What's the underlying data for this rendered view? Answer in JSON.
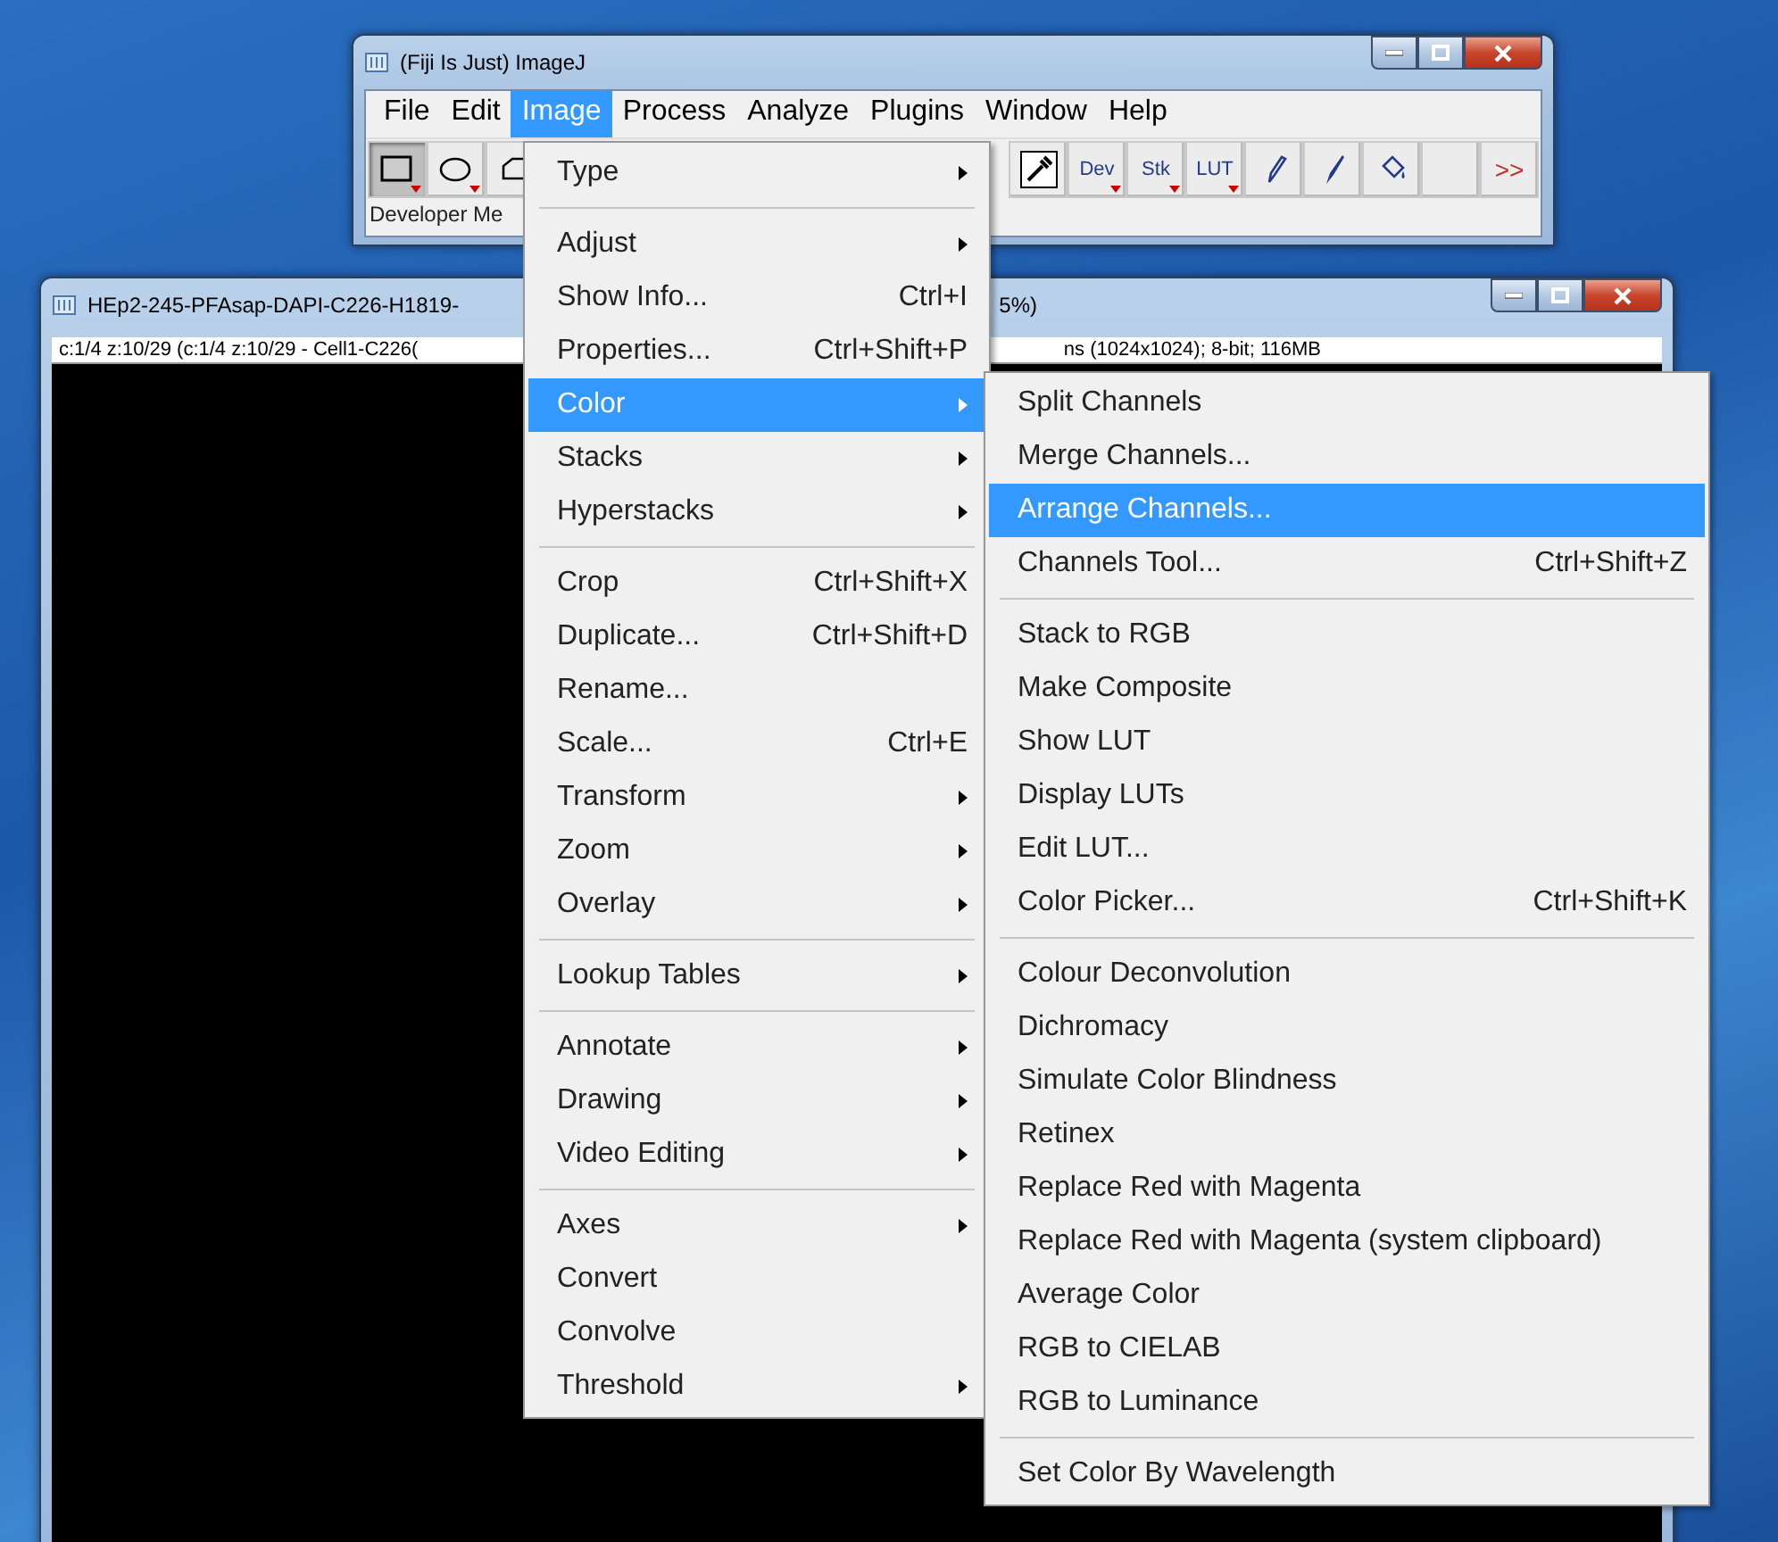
{
  "main_window": {
    "title": "(Fiji Is Just) ImageJ",
    "menu_bar": [
      {
        "label": "File",
        "selected": false
      },
      {
        "label": "Edit",
        "selected": false
      },
      {
        "label": "Image",
        "selected": true
      },
      {
        "label": "Process",
        "selected": false
      },
      {
        "label": "Analyze",
        "selected": false
      },
      {
        "label": "Plugins",
        "selected": false
      },
      {
        "label": "Window",
        "selected": false
      },
      {
        "label": "Help",
        "selected": false
      }
    ],
    "tools_left": [
      {
        "kind": "rectangle",
        "selected": true,
        "dropdown": true
      },
      {
        "kind": "oval",
        "selected": false,
        "dropdown": true
      },
      {
        "kind": "polygon",
        "selected": false
      }
    ],
    "tools_right": [
      {
        "kind": "eyedropper",
        "selected": false,
        "dropdown": false
      },
      {
        "kind": "text",
        "label": "Dev",
        "selected": false,
        "dropdown": true
      },
      {
        "kind": "text",
        "label": "Stk",
        "selected": false,
        "dropdown": true
      },
      {
        "kind": "text",
        "label": "LUT",
        "selected": false,
        "dropdown": true
      },
      {
        "kind": "pencil",
        "selected": false,
        "dropdown": false
      },
      {
        "kind": "brush",
        "selected": false,
        "dropdown": false
      },
      {
        "kind": "fill",
        "selected": false,
        "dropdown": false
      },
      {
        "kind": "blank",
        "selected": false,
        "dropdown": false
      },
      {
        "kind": "more",
        "label": ">>",
        "selected": false,
        "dropdown": false
      }
    ],
    "status": "Developer Me"
  },
  "image_window": {
    "title_left": "HEp2-245-PFAsap-DAPI-C226-H1819-",
    "title_right": "5%)",
    "info_left": "c:1/4 z:10/29 (c:1/4  z:10/29 - Cell1-C226(",
    "info_right": "ns (1024x1024); 8-bit; 116MB"
  },
  "image_menu": [
    [
      {
        "label": "Type",
        "submenu": true,
        "selected": false
      }
    ],
    [
      {
        "label": "Adjust",
        "submenu": true,
        "selected": false
      },
      {
        "label": "Show Info...",
        "shortcut": "Ctrl+I",
        "submenu": false,
        "selected": false
      },
      {
        "label": "Properties...",
        "shortcut": "Ctrl+Shift+P",
        "submenu": false,
        "selected": false
      },
      {
        "label": "Color",
        "submenu": true,
        "selected": true
      },
      {
        "label": "Stacks",
        "submenu": true,
        "selected": false
      },
      {
        "label": "Hyperstacks",
        "submenu": true,
        "selected": false
      }
    ],
    [
      {
        "label": "Crop",
        "shortcut": "Ctrl+Shift+X",
        "submenu": false,
        "selected": false
      },
      {
        "label": "Duplicate...",
        "shortcut": "Ctrl+Shift+D",
        "submenu": false,
        "selected": false
      },
      {
        "label": "Rename...",
        "submenu": false,
        "selected": false
      },
      {
        "label": "Scale...",
        "shortcut": "Ctrl+E",
        "submenu": false,
        "selected": false
      },
      {
        "label": "Transform",
        "submenu": true,
        "selected": false
      },
      {
        "label": "Zoom",
        "submenu": true,
        "selected": false
      },
      {
        "label": "Overlay",
        "submenu": true,
        "selected": false
      }
    ],
    [
      {
        "label": "Lookup Tables",
        "submenu": true,
        "selected": false
      }
    ],
    [
      {
        "label": "Annotate",
        "submenu": true,
        "selected": false
      },
      {
        "label": "Drawing",
        "submenu": true,
        "selected": false
      },
      {
        "label": "Video Editing",
        "submenu": true,
        "selected": false
      }
    ],
    [
      {
        "label": "Axes",
        "submenu": true,
        "selected": false
      },
      {
        "label": "Convert",
        "submenu": false,
        "selected": false
      },
      {
        "label": "Convolve",
        "submenu": false,
        "selected": false
      },
      {
        "label": "Threshold",
        "submenu": true,
        "selected": false
      }
    ]
  ],
  "color_menu": [
    [
      {
        "label": "Split Channels",
        "submenu": false,
        "selected": false
      },
      {
        "label": "Merge Channels...",
        "submenu": false,
        "selected": false
      },
      {
        "label": "Arrange Channels...",
        "submenu": false,
        "selected": true
      },
      {
        "label": "Channels Tool...",
        "shortcut": "Ctrl+Shift+Z",
        "submenu": false,
        "selected": false
      }
    ],
    [
      {
        "label": "Stack to RGB",
        "submenu": false,
        "selected": false
      },
      {
        "label": "Make Composite",
        "submenu": false,
        "selected": false
      },
      {
        "label": "Show LUT",
        "submenu": false,
        "selected": false
      },
      {
        "label": "Display LUTs",
        "submenu": false,
        "selected": false
      },
      {
        "label": "Edit LUT...",
        "submenu": false,
        "selected": false
      },
      {
        "label": "Color Picker...",
        "shortcut": "Ctrl+Shift+K",
        "submenu": false,
        "selected": false
      }
    ],
    [
      {
        "label": "Colour Deconvolution",
        "submenu": false,
        "selected": false
      },
      {
        "label": "Dichromacy",
        "submenu": false,
        "selected": false
      },
      {
        "label": "Simulate Color Blindness",
        "submenu": false,
        "selected": false
      },
      {
        "label": "Retinex",
        "submenu": false,
        "selected": false
      },
      {
        "label": "Replace Red with Magenta",
        "submenu": false,
        "selected": false
      },
      {
        "label": "Replace Red with Magenta (system clipboard)",
        "submenu": false,
        "selected": false
      },
      {
        "label": "Average Color",
        "submenu": false,
        "selected": false
      },
      {
        "label": "RGB to CIELAB",
        "submenu": false,
        "selected": false
      },
      {
        "label": "RGB to Luminance",
        "submenu": false,
        "selected": false
      }
    ],
    [
      {
        "label": "Set Color By Wavelength",
        "submenu": false,
        "selected": false
      }
    ]
  ]
}
